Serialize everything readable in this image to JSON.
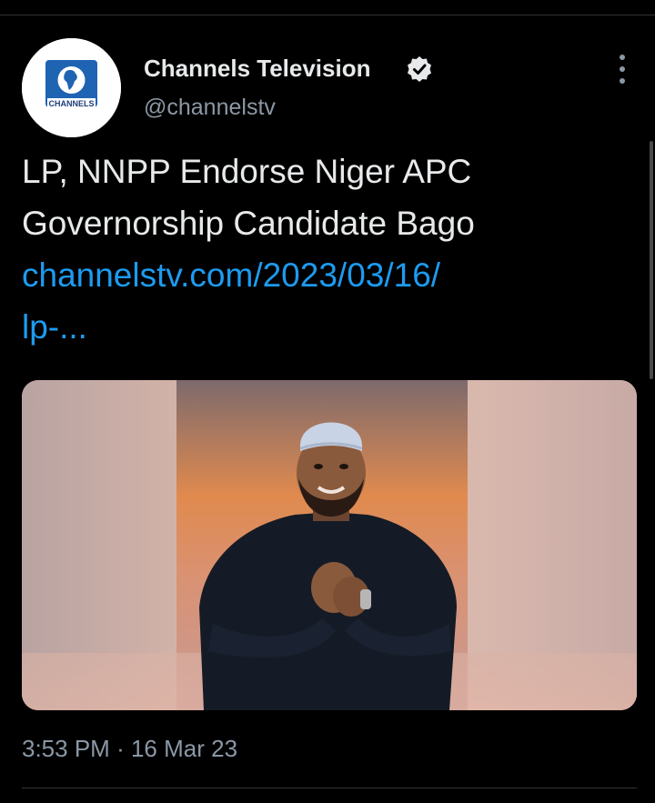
{
  "tweet": {
    "author": {
      "name": "Channels Television",
      "handle": "@channelstv",
      "verified": true,
      "avatar_logo_text": "CHANNELS"
    },
    "text_lines": [
      "LP, NNPP Endorse Niger APC",
      "Governorship Candidate Bago"
    ],
    "link_lines": [
      "channelstv.com/2023/03/16/",
      "lp-..."
    ],
    "timestamp": {
      "time": "3:53 PM",
      "separator": "·",
      "date": "16 Mar 23"
    }
  },
  "icons": {
    "verified": "verified-badge-icon",
    "more": "more-options-icon"
  },
  "colors": {
    "background": "#000000",
    "text": "#e7e9ea",
    "secondary_text": "#8b98a5",
    "link": "#1d9bf0"
  }
}
